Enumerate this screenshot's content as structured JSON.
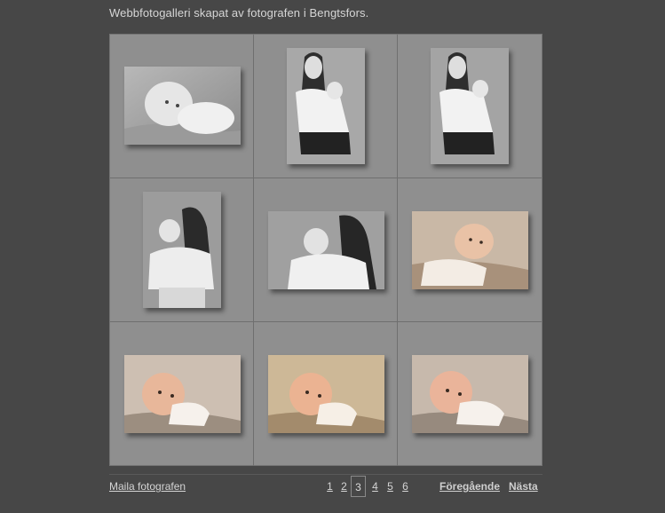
{
  "header": {
    "subtitle": "Webbfotogalleri skapat av fotografen i Bengtsfors."
  },
  "gallery": {
    "thumbnails": [
      {
        "style": "bw",
        "subject": "baby-lying"
      },
      {
        "style": "bw",
        "subject": "woman-holding-baby"
      },
      {
        "style": "bw",
        "subject": "woman-holding-baby"
      },
      {
        "style": "bw",
        "subject": "woman-holding-baby-back"
      },
      {
        "style": "bw",
        "subject": "woman-holding-baby-back"
      },
      {
        "style": "color",
        "subject": "baby-lying"
      },
      {
        "style": "color",
        "subject": "baby-lying"
      },
      {
        "style": "color",
        "subject": "baby-lying"
      },
      {
        "style": "color",
        "subject": "baby-lying"
      }
    ]
  },
  "footer": {
    "mail_label": "Maila fotografen",
    "pages": [
      "1",
      "2",
      "3",
      "4",
      "5",
      "6"
    ],
    "current_page": "3",
    "prev_label": "Föregående",
    "next_label": "Nästa"
  },
  "colors": {
    "background": "#474747",
    "grid_background": "#8f8f8f",
    "link": "#d4d4d4"
  }
}
